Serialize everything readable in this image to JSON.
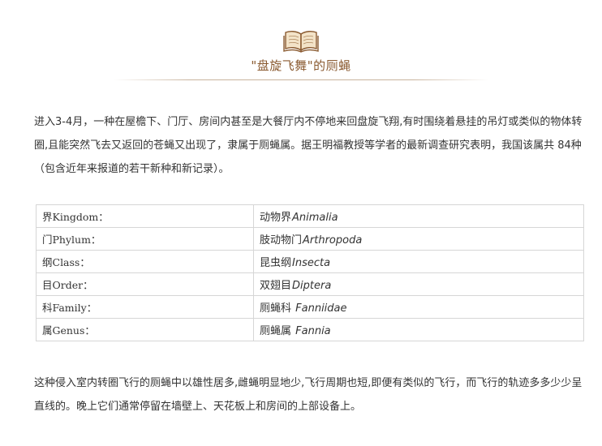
{
  "article": {
    "title": "\"盘旋飞舞\"的厕蝇",
    "intro": "进入3-4月，一种在屋檐下、门厅、房间内甚至是大餐厅内不停地来回盘旋飞翔,有时围绕着悬挂的吊灯或类似的物体转圈,且能突然飞去又返回的苍蝇又出现了，隶属于厕蝇属。据王明福教授等学者的最新调查研究表明，我国该属共 84种 （包含近年来报道的若干新种和新记录）。",
    "outro": "这种侵入室内转圈飞行的厕蝇中以雄性居多,雌蝇明显地少,飞行周期也短,即便有类似的飞行，而飞行的轨迹多多少少呈直线的。晚上它们通常停留在墙壁上、天花板上和房间的上部设备上。"
  },
  "taxonomy": {
    "rows": [
      {
        "rank": "界Kingdom：",
        "name": "动物界",
        "latin": "Animalia"
      },
      {
        "rank": "门Phylum：",
        "name": "肢动物门",
        "latin": "Arthropoda"
      },
      {
        "rank": "纲Class：",
        "name": "昆虫纲",
        "latin": "Insecta"
      },
      {
        "rank": "目Order：",
        "name": "双翅目",
        "latin": "Diptera"
      },
      {
        "rank": "科Family：",
        "name": "厕蝇科 ",
        "latin": "Fanniidae"
      },
      {
        "rank": "属Genus：",
        "name": "厕蝇属  ",
        "latin": "Fannia"
      }
    ]
  },
  "icons": {
    "header_icon": "open-book-icon"
  },
  "colors": {
    "title": "#8a5a30",
    "divider": "#c9b49e",
    "table_border": "#d6d6d6"
  }
}
